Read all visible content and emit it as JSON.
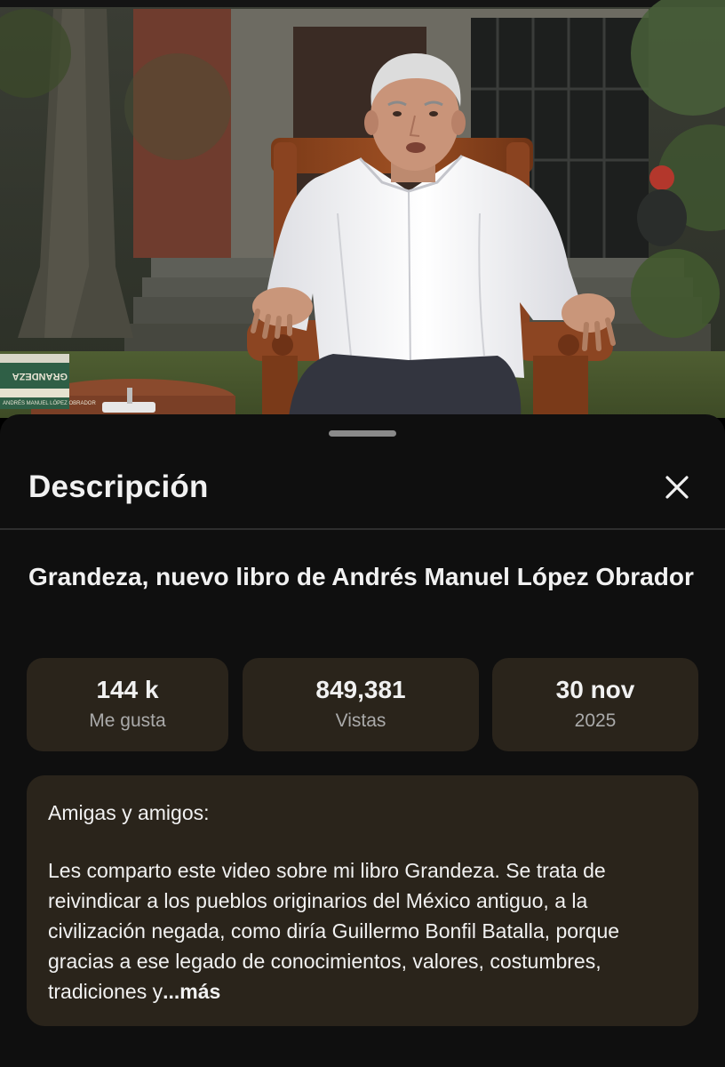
{
  "sheet": {
    "title": "Descripción"
  },
  "video": {
    "title": "Grandeza, nuevo libro de Andrés Manuel López Obrador"
  },
  "stats": [
    {
      "value": "144 k",
      "label": "Me gusta"
    },
    {
      "value": "849,381",
      "label": "Vistas"
    },
    {
      "value": "30 nov",
      "label": "2025"
    }
  ],
  "description": {
    "greeting": "Amigas y amigos:",
    "body": "Les comparto este video sobre mi libro Grandeza. Se trata de reivindicar a los pueblos originarios del México antiguo, a la civilización negada, como diría Guillermo Bonfil Batalla, porque gracias a ese legado de conocimientos, valores, costumbres, tradiciones y",
    "more_label": "...más"
  },
  "book": {
    "cover_text": "GRANDEZA",
    "spine_text": "ANDRÉS MANUEL LÓPEZ OBRADOR"
  },
  "icons": {
    "close": "close-icon"
  },
  "colors": {
    "sheet_background": "#0f0f0f",
    "card_background": "#2a241b",
    "primary_text": "#f1f1f1",
    "secondary_text": "#aaaaaa"
  }
}
